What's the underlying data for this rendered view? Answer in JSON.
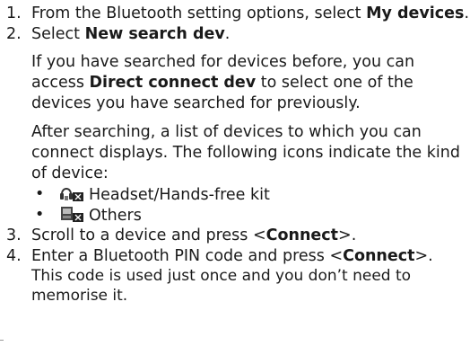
{
  "steps": [
    {
      "number": "1.",
      "text_before": "From the Bluetooth setting options, select ",
      "bold": "My devices",
      "text_after": "."
    },
    {
      "number": "2.",
      "text_before": "Select ",
      "bold": "New search dev",
      "text_after": ".",
      "note1_before": "If you have searched for devices before, you can access ",
      "note1_bold": "Direct connect dev",
      "note1_after": " to select one of the devices you have searched for previously.",
      "note2": "After searching, a list of devices to which you can connect displays. The following icons indicate the kind of device:",
      "icons": [
        {
          "icon": "headset-icon",
          "label": "Headset/Hands-free kit"
        },
        {
          "icon": "others-device-icon",
          "label": "Others"
        }
      ]
    },
    {
      "number": "3.",
      "text_before": "Scroll to a device and press <",
      "bold": "Connect",
      "text_after": ">."
    },
    {
      "number": "4.",
      "text_before": "Enter a Bluetooth PIN code and press <",
      "bold": "Connect",
      "text_after": ">.",
      "continuation": "This code is used just once and you don’t need to memorise it."
    }
  ],
  "bullet_char": "•"
}
